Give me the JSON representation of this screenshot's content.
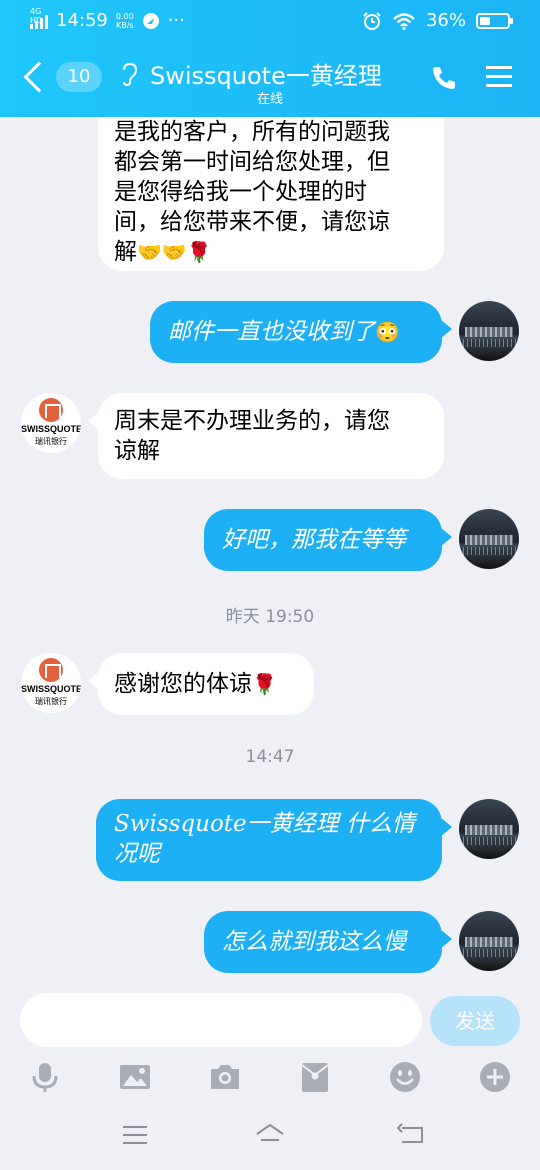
{
  "status_bar": {
    "network": "4G HD",
    "time": "14:59",
    "speed_value": "0.00",
    "speed_unit": "KB/s",
    "more": "···",
    "battery": "36%"
  },
  "header": {
    "unread_count": "10",
    "title": "Swissquote一黄经理",
    "subtitle": "在线"
  },
  "contact": {
    "name": "SWISSQUOTE",
    "sub": "瑞讯银行"
  },
  "messages": [
    {
      "side": "in",
      "lines": [
        "是我的客户，所有的问题我",
        "都会第一时间给您处理，但",
        "是您得给我一个处理的时",
        "间，给您带来不便，请您谅",
        "解"
      ],
      "emoji": "🤝🤝🌹"
    },
    {
      "side": "out",
      "text": "邮件一直也没收到了",
      "emoji": "😳"
    },
    {
      "side": "in",
      "lines": [
        "周末是不办理业务的，请您",
        "谅解"
      ]
    },
    {
      "side": "out",
      "text": "好吧，那我在等等"
    },
    {
      "side": "in",
      "text": "感谢您的体谅",
      "emoji": "🌹"
    },
    {
      "side": "out",
      "lines": [
        "Swissquote一黄经理 什么情",
        "况呢"
      ]
    },
    {
      "side": "out",
      "text": "怎么就到我这么慢"
    }
  ],
  "timestamps": [
    "昨天 19:50",
    "14:47"
  ],
  "input": {
    "placeholder": "",
    "send_label": "发送"
  },
  "toolbar_icons": [
    "mic-icon",
    "image-icon",
    "camera-icon",
    "red-packet-icon",
    "emoji-icon",
    "plus-icon"
  ],
  "nav_icons": [
    "menu-icon",
    "home-icon",
    "back-icon"
  ],
  "colors": {
    "header": "#1ec6fa",
    "bubble_out": "#1eb0f4",
    "background": "#eef0f6",
    "send_disabled": "#b6e3fb"
  }
}
